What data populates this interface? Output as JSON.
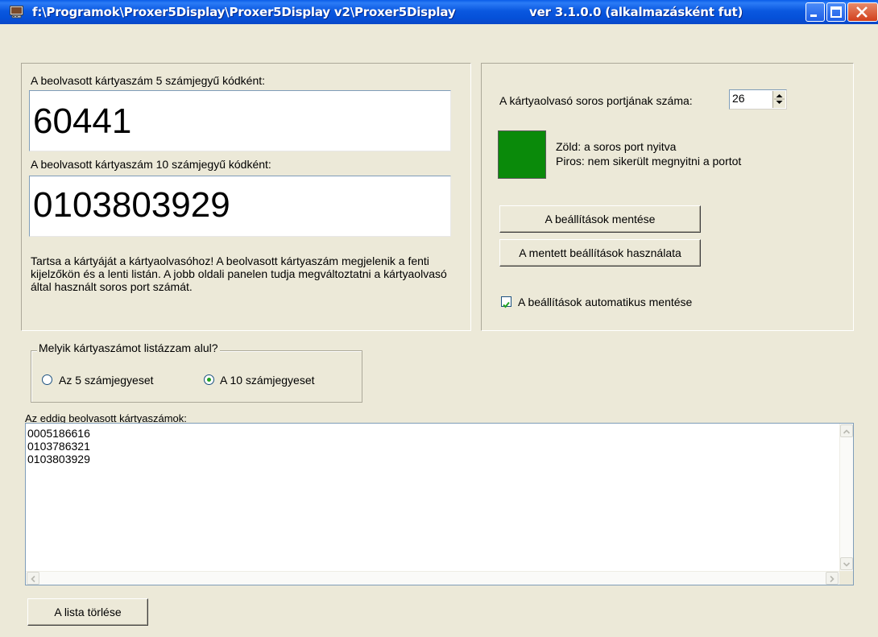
{
  "window": {
    "title_path": "f:\\Programok\\Proxer5Display\\Proxer5Display v2\\Proxer5Display",
    "title_version": "ver 3.1.0.0 (alkalmazásként fut)"
  },
  "left_panel": {
    "label_5digit": "A beolvasott kártyaszám 5 számjegyű kódként:",
    "value_5digit": "60441",
    "label_10digit": "A beolvasott kártyaszám 10 számjegyű kódként:",
    "value_10digit": "0103803929",
    "info_text": "Tartsa a kártyáját a kártyaolvasóhoz! A beolvasott kártyaszám megjelenik a fenti kijelzőkön és a lenti listán. A jobb oldali panelen tudja megváltoztatni a kártyaolvasó által használt soros port számát."
  },
  "right_panel": {
    "port_label": "A kártyaolvasó soros portjának száma:",
    "port_value": "26",
    "status_color": "#0a8a0a",
    "status_green_text": "Zöld: a soros port nyitva",
    "status_red_text": "Piros: nem sikerült megnyitni a portot",
    "save_button": "A beállítások mentése",
    "load_button": "A mentett beállítások használata",
    "autosave_label": "A beállítások automatikus mentése",
    "autosave_checked": true
  },
  "list_group": {
    "legend": "Melyik kártyaszámot listázzam alul?",
    "option_5": "Az 5 számjegyeset",
    "option_10": "A 10 számjegyeset",
    "selected": "10"
  },
  "list": {
    "label": "Az eddig beolvasott kártyaszámok:",
    "items": [
      "0005186616",
      "0103786321",
      "0103803929"
    ],
    "clear_button": "A lista törlése"
  }
}
